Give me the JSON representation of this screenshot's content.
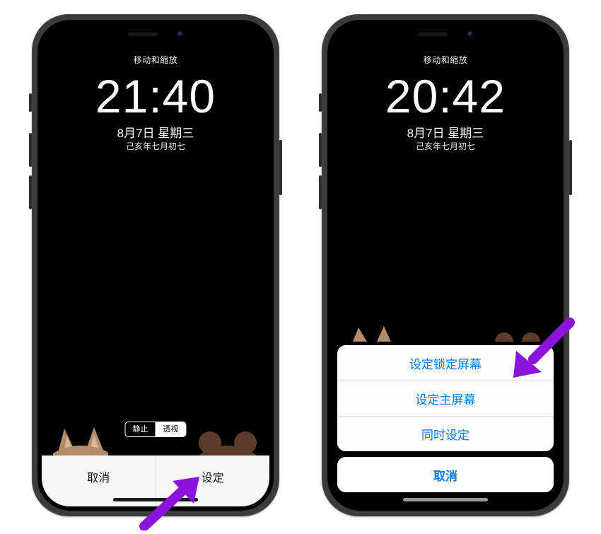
{
  "colors": {
    "accent": "#007aff",
    "arrow": "#8a14db"
  },
  "left": {
    "title": "移动和缩放",
    "time": "21:40",
    "date": "8月7日 星期三",
    "lunar": "己亥年七月初七",
    "segmented": {
      "opt1": "静止",
      "opt2": "透视",
      "active": 1
    },
    "buttons": {
      "cancel": "取消",
      "set": "设定"
    }
  },
  "right": {
    "title": "移动和缩放",
    "time": "20:42",
    "date": "8月7日 星期三",
    "lunar": "己亥年七月初七",
    "sheet": {
      "opt_lock": "设定锁定屏幕",
      "opt_home": "设定主屏幕",
      "opt_both": "同时设定",
      "cancel": "取消"
    }
  }
}
